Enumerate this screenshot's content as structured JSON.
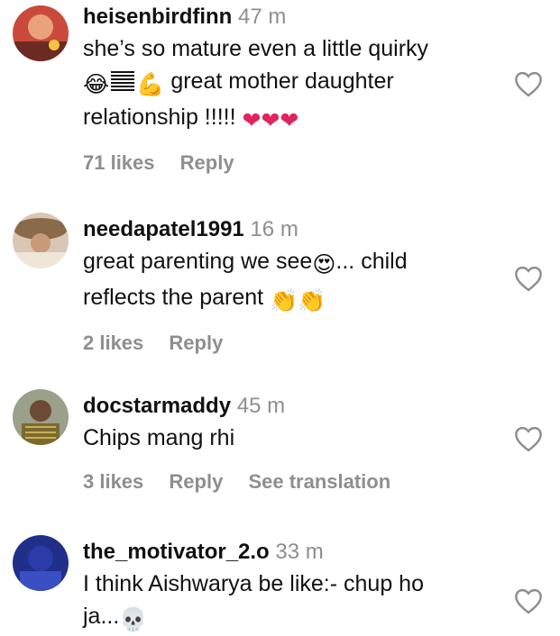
{
  "comments": [
    {
      "username": "heisenbirdfinn",
      "time": "47 m",
      "text_line1": "she’s so mature even a little quirky",
      "text_line2": "great mother daughter",
      "text_line3": "relationship !!!!!",
      "likes": "71 likes",
      "reply": "Reply"
    },
    {
      "username": "needapatel1991",
      "time": "16 m",
      "text_line1a": "great parenting we see",
      "text_line1b": "... child",
      "text_line2": "reflects the parent",
      "likes": "2 likes",
      "reply": "Reply"
    },
    {
      "username": "docstarmaddy",
      "time": "45 m",
      "text_line1": "Chips mang rhi",
      "likes": "3 likes",
      "reply": "Reply",
      "translate": "See translation"
    },
    {
      "username": "the_motivator_2.o",
      "time": "33 m",
      "text_line1": "I think Aishwarya be like:- chup ho",
      "text_line2": "ja..."
    }
  ],
  "icons": {
    "like": "heart-outline-icon",
    "emoji_joy": "😂",
    "emoji_muscle": "💪",
    "emoji_heart": "❤",
    "emoji_heart_eyes": "😍",
    "emoji_clap": "👏",
    "emoji_skull": "💀"
  },
  "colors": {
    "text": "#111111",
    "muted": "#8e8e8e",
    "heart_red": "#e0245e"
  }
}
